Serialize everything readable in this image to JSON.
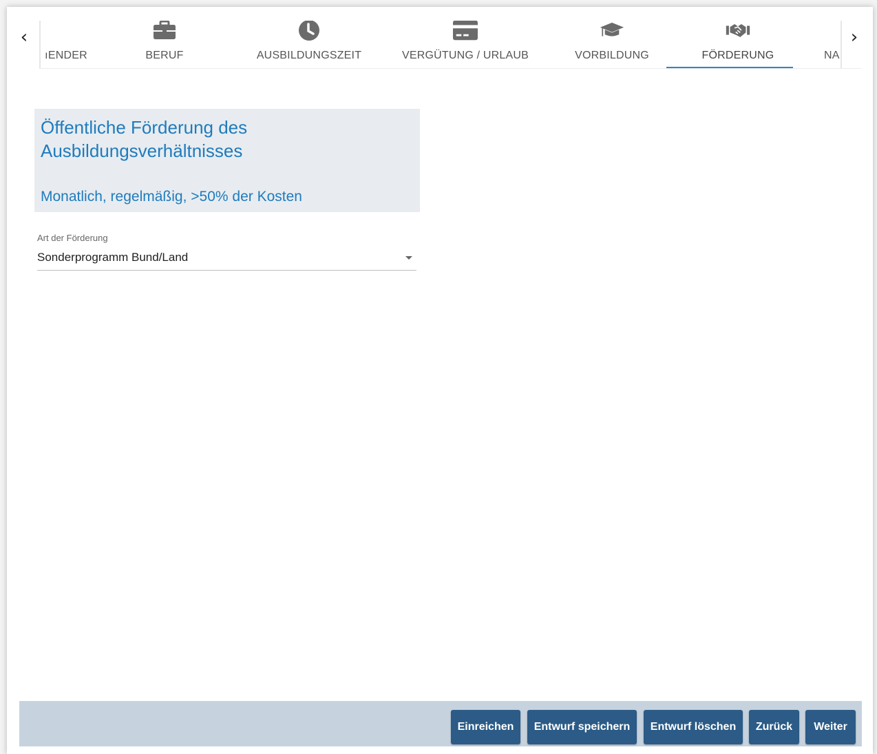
{
  "tabs": [
    {
      "label": "ıENDER",
      "icon": "none"
    },
    {
      "label": "BERUF",
      "icon": "briefcase-icon"
    },
    {
      "label": "AUSBILDUNGSZEIT",
      "icon": "clock-icon"
    },
    {
      "label": "VERGÜTUNG / URLAUB",
      "icon": "credit-card-icon"
    },
    {
      "label": "VORBILDUNG",
      "icon": "graduation-cap-icon"
    },
    {
      "label": "FÖRDERUNG",
      "icon": "handshake-icon",
      "active": true
    },
    {
      "label": "NA",
      "icon": "none"
    }
  ],
  "nav": {
    "prev": "‹",
    "next": "›"
  },
  "section": {
    "title": "Öffentliche Förderung des Ausbildungsverhältnisses",
    "subtitle": "Monatlich, regelmäßig, >50% der Kosten"
  },
  "foerderung_field": {
    "label": "Art der Förderung",
    "value": "Sonderprogramm Bund/Land"
  },
  "footer": {
    "submit": "Einreichen",
    "save_draft": "Entwurf speichern",
    "delete_draft": "Entwurf löschen",
    "back": "Zurück",
    "next": "Weiter"
  },
  "colors": {
    "accent": "#1f7bbd",
    "button": "#2b5b86",
    "footer_bg": "#c6d3df",
    "header_bg": "#e8ecf0",
    "icon": "#6b6b6b"
  }
}
